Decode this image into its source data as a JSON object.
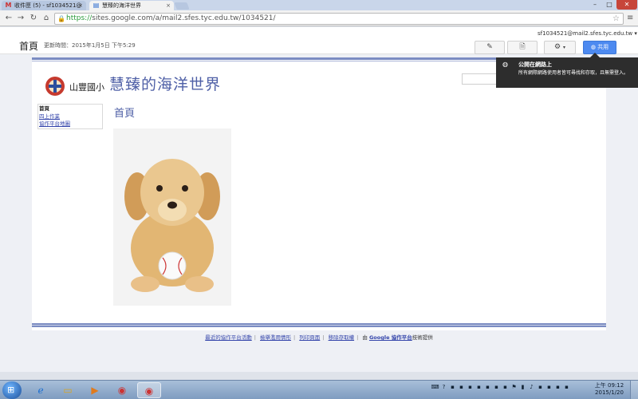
{
  "browser": {
    "tabs": [
      {
        "title": "收件匣 (5) - sf1034521@",
        "icon": "gmail-icon",
        "active": false
      },
      {
        "title": "慧臻的海洋世界",
        "icon": "sites-icon",
        "active": true
      }
    ],
    "url_scheme": "https://",
    "url_rest": "sites.google.com/a/mail2.sfes.tyc.edu.tw/1034521/"
  },
  "sites_bar": {
    "page_title": "首頁",
    "updated": "更新時間：2015年1月5日 下午5:29",
    "account": "sf1034521@mail2.sfes.tyc.edu.tw",
    "share_label": "共用"
  },
  "tooltip": {
    "title": "公開在網路上",
    "description": "所有網際網路使用者皆可尋找和存取，且無需登入。"
  },
  "site": {
    "logo_school": "山豐國小",
    "title": "慧臻的海洋世界",
    "nav": [
      {
        "label": "首頁",
        "current": true
      },
      {
        "label": "四上作業",
        "current": false
      },
      {
        "label": "協作平台地圖",
        "current": false
      }
    ],
    "content_heading": "首頁"
  },
  "footer": {
    "links": [
      "最近的協作平台活動",
      "檢舉濫用情形",
      "列印頁面",
      "移除存取權"
    ],
    "powered_prefix": "由",
    "powered_brand": "Google 協作平台",
    "powered_suffix": "技術提供"
  },
  "taskbar": {
    "time": "上午 09:12",
    "date": "2015/1/20"
  },
  "colors": {
    "accent": "#4e5fa6",
    "share": "#4d8af0",
    "link": "#3344aa"
  }
}
